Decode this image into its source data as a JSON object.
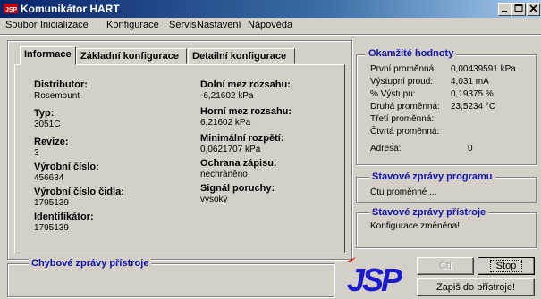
{
  "window": {
    "title": "Komunikátor HART"
  },
  "menu": [
    "Soubor",
    "Inicializace",
    "Konfigurace",
    "Servis",
    "Nastavení",
    "Nápověda"
  ],
  "menu_underline": [
    "S",
    "I",
    "K",
    "e",
    "N",
    "á"
  ],
  "tabs": [
    "Informace",
    "Základní konfigurace",
    "Detailní konfigurace"
  ],
  "info": {
    "distributor_label": "Distributor:",
    "distributor": "Rosemount",
    "type_label": "Typ:",
    "type": "3051C",
    "revision_label": "Revize:",
    "revision": "3",
    "serial_label": "Výrobní číslo:",
    "serial": "456634",
    "sensor_serial_label": "Výrobní číslo čidla:",
    "sensor_serial": "1795139",
    "identifier_label": "Identifikátor:",
    "identifier": "1795139",
    "lower_limit_label": "Dolní mez rozsahu:",
    "lower_limit": "-6,21602 kPa",
    "upper_limit_label": "Horní mez rozsahu:",
    "upper_limit": "6,21602 kPa",
    "min_span_label": "Minimální rozpětí:",
    "min_span": "0,0621707 kPa",
    "write_protect_label": "Ochrana zápisu:",
    "write_protect": "nechráněno",
    "fault_signal_label": "Signál poruchy:",
    "fault_signal": "vysoký"
  },
  "instant": {
    "title": "Okamžité hodnoty",
    "rows": [
      {
        "label": "První proměnná:",
        "value": "0,00439591 kPa"
      },
      {
        "label": "Výstupní proud:",
        "value": "4,031 mA"
      },
      {
        "label": "% Výstupu:",
        "value": "0,19375 %"
      },
      {
        "label": "Druhá proměnná:",
        "value": "23,5234 °C"
      },
      {
        "label": "Třetí proměnná:",
        "value": ""
      },
      {
        "label": "Čtvrtá proměnná:",
        "value": ""
      },
      {
        "label": "Adresa:",
        "value": "0"
      }
    ]
  },
  "program_status": {
    "title": "Stavové zprávy programu",
    "text": "Čtu proměnné ..."
  },
  "device_status": {
    "title": "Stavové zprávy přístroje",
    "text": "Konfigurace změněna!"
  },
  "device_errors": {
    "title": "Chybové zprávy přístroje"
  },
  "buttons": {
    "read": "Čtí",
    "stop": "Stop",
    "write": "Zapiš do přístroje!"
  },
  "logo": {
    "text": "JSP",
    "color": "#1a1ad0",
    "accent": "#e00000"
  }
}
